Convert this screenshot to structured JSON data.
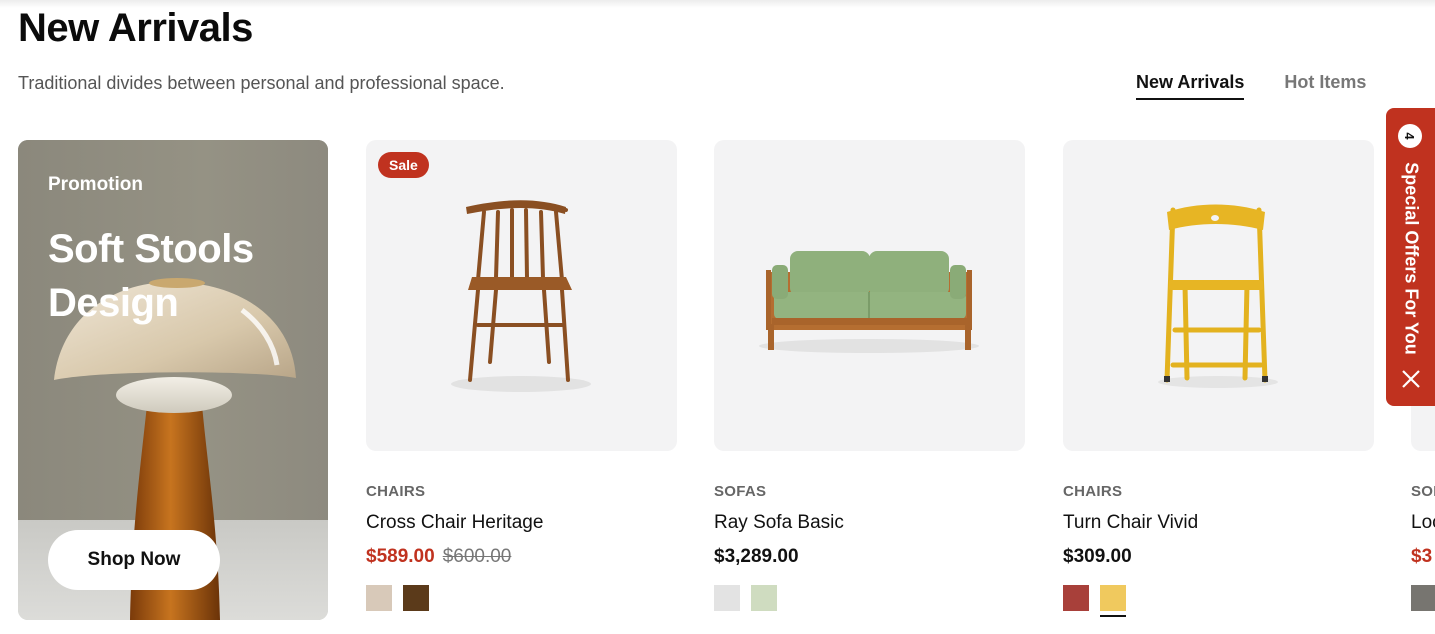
{
  "section": {
    "title": "New Arrivals",
    "subtitle": "Traditional divides between personal and professional space."
  },
  "tabs": [
    {
      "label": "New Arrivals",
      "active": true
    },
    {
      "label": "Hot Items",
      "active": false
    }
  ],
  "promo": {
    "label": "Promotion",
    "title": "Soft Stools Design",
    "button": "Shop Now"
  },
  "products": [
    {
      "badge": "Sale",
      "category": "CHAIRS",
      "name": "Cross Chair Heritage",
      "price": "$589.00",
      "old_price": "$600.00",
      "swatches": [
        "#d8c9b9",
        "#5b3a1a"
      ]
    },
    {
      "category": "SOFAS",
      "name": "Ray Sofa Basic",
      "price": "$3,289.00",
      "swatches": [
        "#e3e3e3",
        "#cfdcc0"
      ]
    },
    {
      "category": "CHAIRS",
      "name": "Turn Chair Vivid",
      "price": "$309.00",
      "swatches": [
        "#a8403a",
        "#f0c95e"
      ],
      "selected_swatch": 1
    }
  ],
  "partial_product": {
    "category": "SOI",
    "name": "Loc",
    "price": "$3",
    "swatch": "#777570"
  },
  "side_tab": {
    "count": "4",
    "label": "Special Offers For You"
  },
  "colors": {
    "accent": "#c0321f",
    "thumb_bg": "#f3f3f4"
  }
}
